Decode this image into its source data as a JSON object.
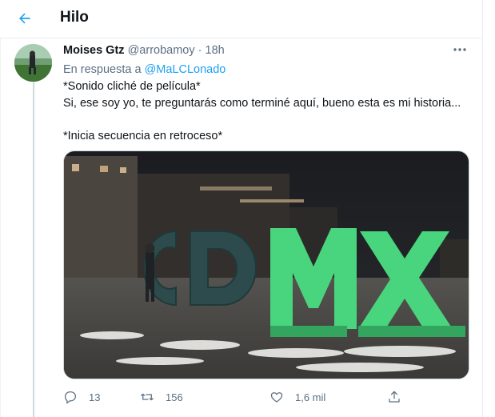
{
  "header": {
    "title": "Hilo",
    "back_icon": "arrow-left-icon"
  },
  "tweet": {
    "author_name": "Moises Gtz",
    "author_handle": "@arrobamoy",
    "separator": "·",
    "time": "18h",
    "reply_prefix": "En respuesta a",
    "reply_to": "@MaLCLonado",
    "lines": [
      "*Sonido cliché de película*",
      "Si, ese soy yo, te preguntarás como terminé aquí, bueno esta es mi historia...",
      "*Inicia secuencia en retroceso*"
    ],
    "media": {
      "sign_letters": "CDMX"
    },
    "stats": {
      "replies": "13",
      "retweets": "156",
      "likes": "1,6 mil"
    }
  },
  "colors": {
    "accent": "#1da1f2",
    "muted": "#5b7083",
    "text": "#0f1419",
    "border": "#e6ecf0"
  }
}
